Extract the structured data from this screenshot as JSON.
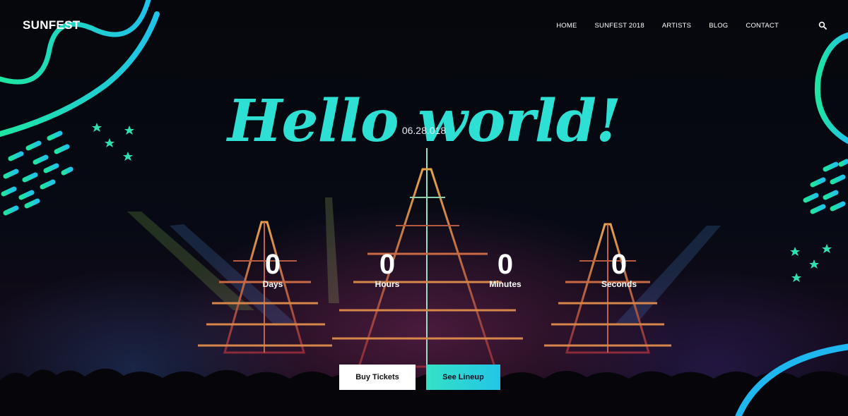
{
  "brand": {
    "logo": "SUNFEST"
  },
  "nav": {
    "items": [
      "HOME",
      "SUNFEST 2018",
      "ARTISTS",
      "BLOG",
      "CONTACT"
    ],
    "search_icon": "search-icon"
  },
  "hero": {
    "date": "06.28.018",
    "headline": "Hello world!"
  },
  "countdown": [
    {
      "value": "0",
      "label": "Days"
    },
    {
      "value": "0",
      "label": "Hours"
    },
    {
      "value": "0",
      "label": "Minutes"
    },
    {
      "value": "0",
      "label": "Seconds"
    }
  ],
  "actions": {
    "buy_tickets": "Buy Tickets",
    "see_lineup": "See Lineup"
  },
  "colors": {
    "accent_teal": "#2ee0d4",
    "accent_cyan": "#22c6e6",
    "accent_green": "#35e1a6",
    "background": "#05070d"
  }
}
